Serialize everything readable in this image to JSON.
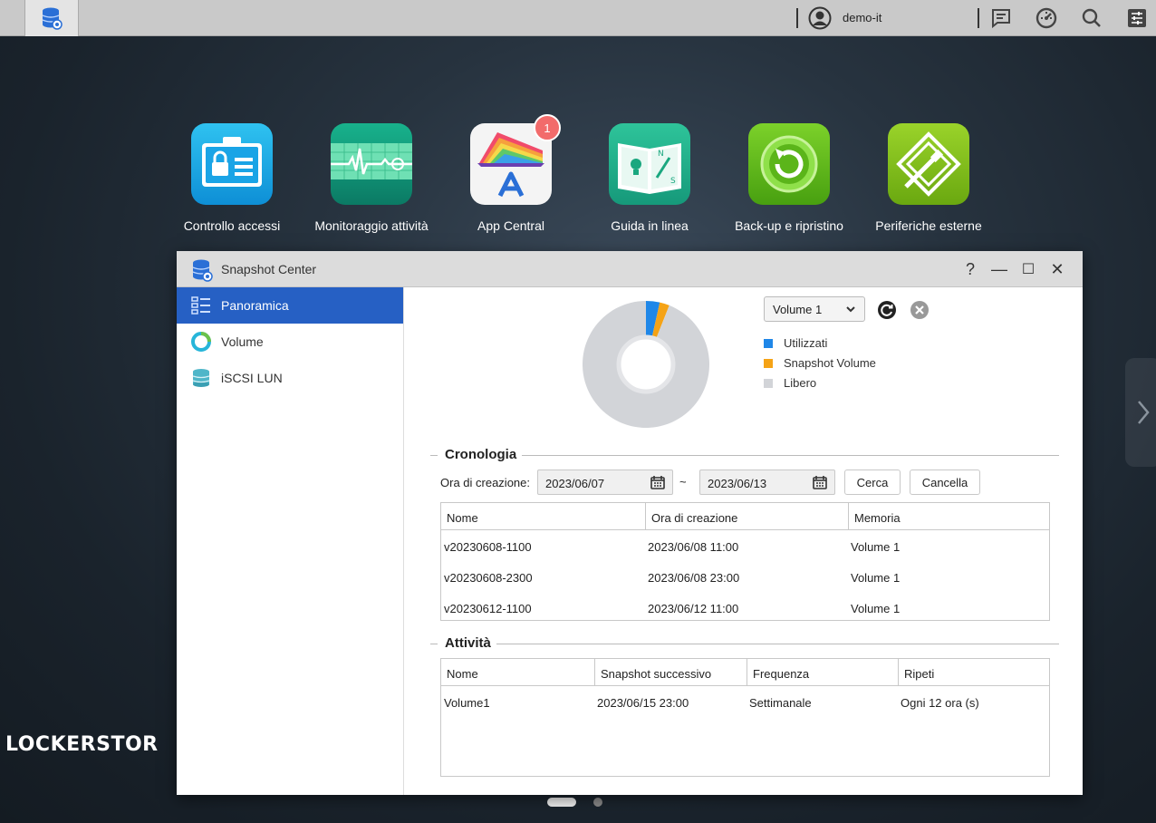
{
  "topbar": {
    "user": "demo-it",
    "icons": [
      "database-icon",
      "user-icon",
      "messages-icon",
      "dashboard-icon",
      "search-icon",
      "settings-icon"
    ]
  },
  "desktop": {
    "icons": [
      {
        "label": "Controllo accessi",
        "icon": "access-control-icon"
      },
      {
        "label": "Monitoraggio attività",
        "icon": "activity-monitor-icon"
      },
      {
        "label": "App Central",
        "icon": "app-central-icon",
        "badge": "1"
      },
      {
        "label": "Guida in linea",
        "icon": "online-help-icon"
      },
      {
        "label": "Back-up e ripristino",
        "icon": "backup-restore-icon"
      },
      {
        "label": "Periferiche esterne",
        "icon": "external-devices-icon"
      }
    ],
    "brand": "LOCKERSTOR"
  },
  "window": {
    "title": "Snapshot Center",
    "controls": [
      "?",
      "—",
      "☐",
      "✕"
    ],
    "sidebar": [
      {
        "label": "Panoramica",
        "icon": "list-icon",
        "active": true
      },
      {
        "label": "Volume",
        "icon": "volume-icon",
        "active": false
      },
      {
        "label": "iSCSI LUN",
        "icon": "iscsi-icon",
        "active": false
      }
    ],
    "overview": {
      "volume_select": "Volume 1",
      "legend": [
        {
          "label": "Utilizzati",
          "color": "#1f87e8"
        },
        {
          "label": "Snapshot Volume",
          "color": "#f5a316"
        },
        {
          "label": "Libero",
          "color": "#d2d4d8"
        }
      ],
      "usage": {
        "used": 3.5,
        "snapshot": 2.5,
        "free": 94
      }
    },
    "history": {
      "title": "Cronologia",
      "label": "Ora di creazione:",
      "from": "2023/06/07",
      "to": "2023/06/13",
      "tilde": "~",
      "search_btn": "Cerca",
      "cancel_btn": "Cancella",
      "columns": [
        "Nome",
        "Ora di creazione",
        "Memoria"
      ],
      "rows": [
        [
          "v20230608-1100",
          "2023/06/08 11:00",
          "Volume 1"
        ],
        [
          "v20230608-2300",
          "2023/06/08 23:00",
          "Volume 1"
        ],
        [
          "v20230612-1100",
          "2023/06/12 11:00",
          "Volume 1"
        ]
      ]
    },
    "activity": {
      "title": "Attività",
      "columns": [
        "Nome",
        "Snapshot successivo",
        "Frequenza",
        "Ripeti"
      ],
      "rows": [
        [
          "Volume1",
          "2023/06/15 23:00",
          "Settimanale",
          "Ogni 12 ora (s)"
        ]
      ]
    }
  }
}
